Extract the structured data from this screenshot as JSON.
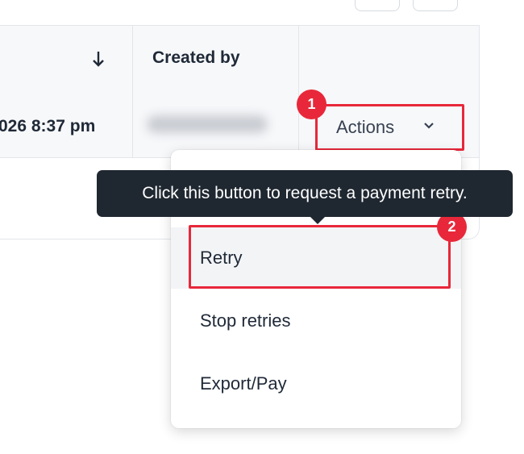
{
  "table": {
    "created_by_header": "Created by",
    "row": {
      "date": "026 8:37 pm"
    }
  },
  "actions_button": {
    "label": "Actions"
  },
  "dropdown": {
    "items": [
      {
        "label": "Retry"
      },
      {
        "label": "Stop retries"
      },
      {
        "label": "Export/Pay"
      }
    ]
  },
  "tooltip": {
    "text": "Click this button to request a payment retry."
  },
  "steps": {
    "first": "1",
    "second": "2"
  },
  "colors": {
    "highlight": "#e8283a",
    "tooltip_bg": "#1f2731"
  },
  "icons": {
    "sort": "arrow-down-icon",
    "dropdown": "chevron-down-icon"
  }
}
